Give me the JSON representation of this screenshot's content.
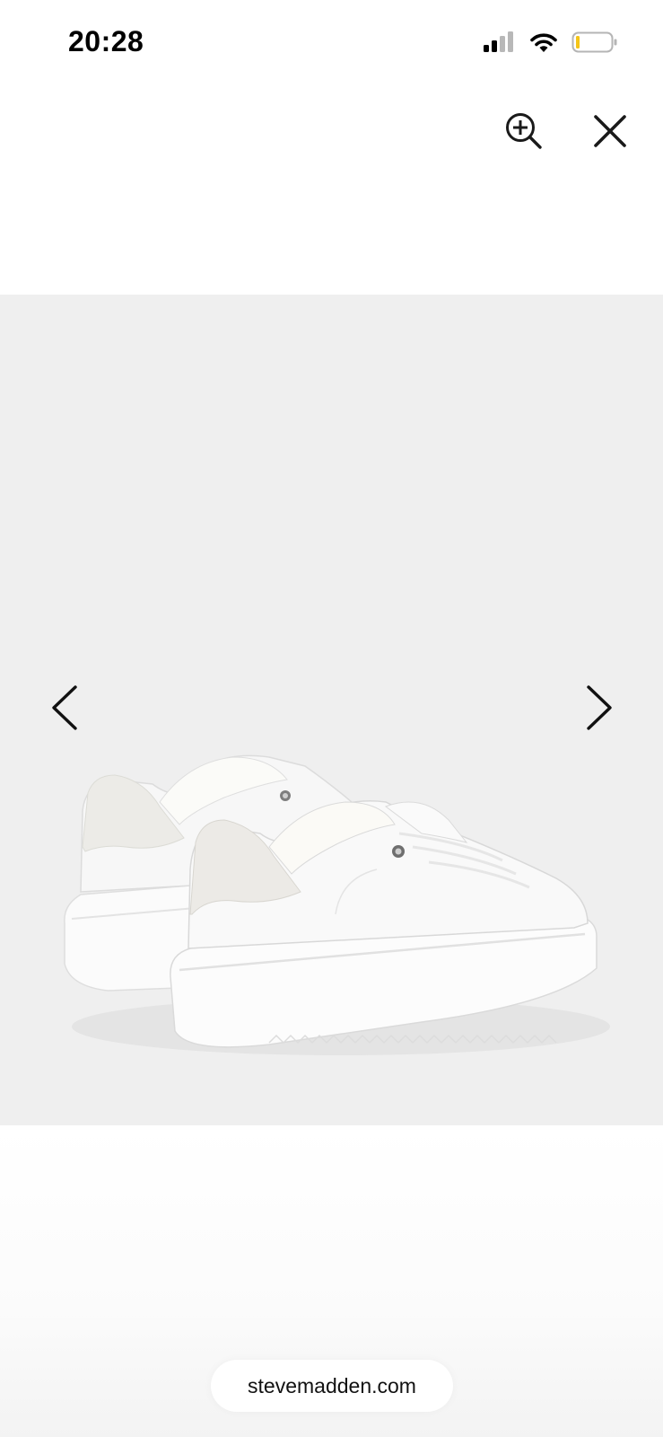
{
  "status_bar": {
    "time": "20:28",
    "signal_icon": "cellular-signal-icon",
    "wifi_icon": "wifi-icon",
    "battery_icon": "battery-low-icon",
    "battery_color": "#f5c518"
  },
  "toolbar": {
    "zoom_icon": "zoom-in-icon",
    "close_icon": "close-icon"
  },
  "viewer": {
    "image_subject": "product-photo",
    "prev_icon": "chevron-left-icon",
    "next_icon": "chevron-right-icon",
    "background_color": "#efefef"
  },
  "browser": {
    "url": "stevemadden.com"
  }
}
